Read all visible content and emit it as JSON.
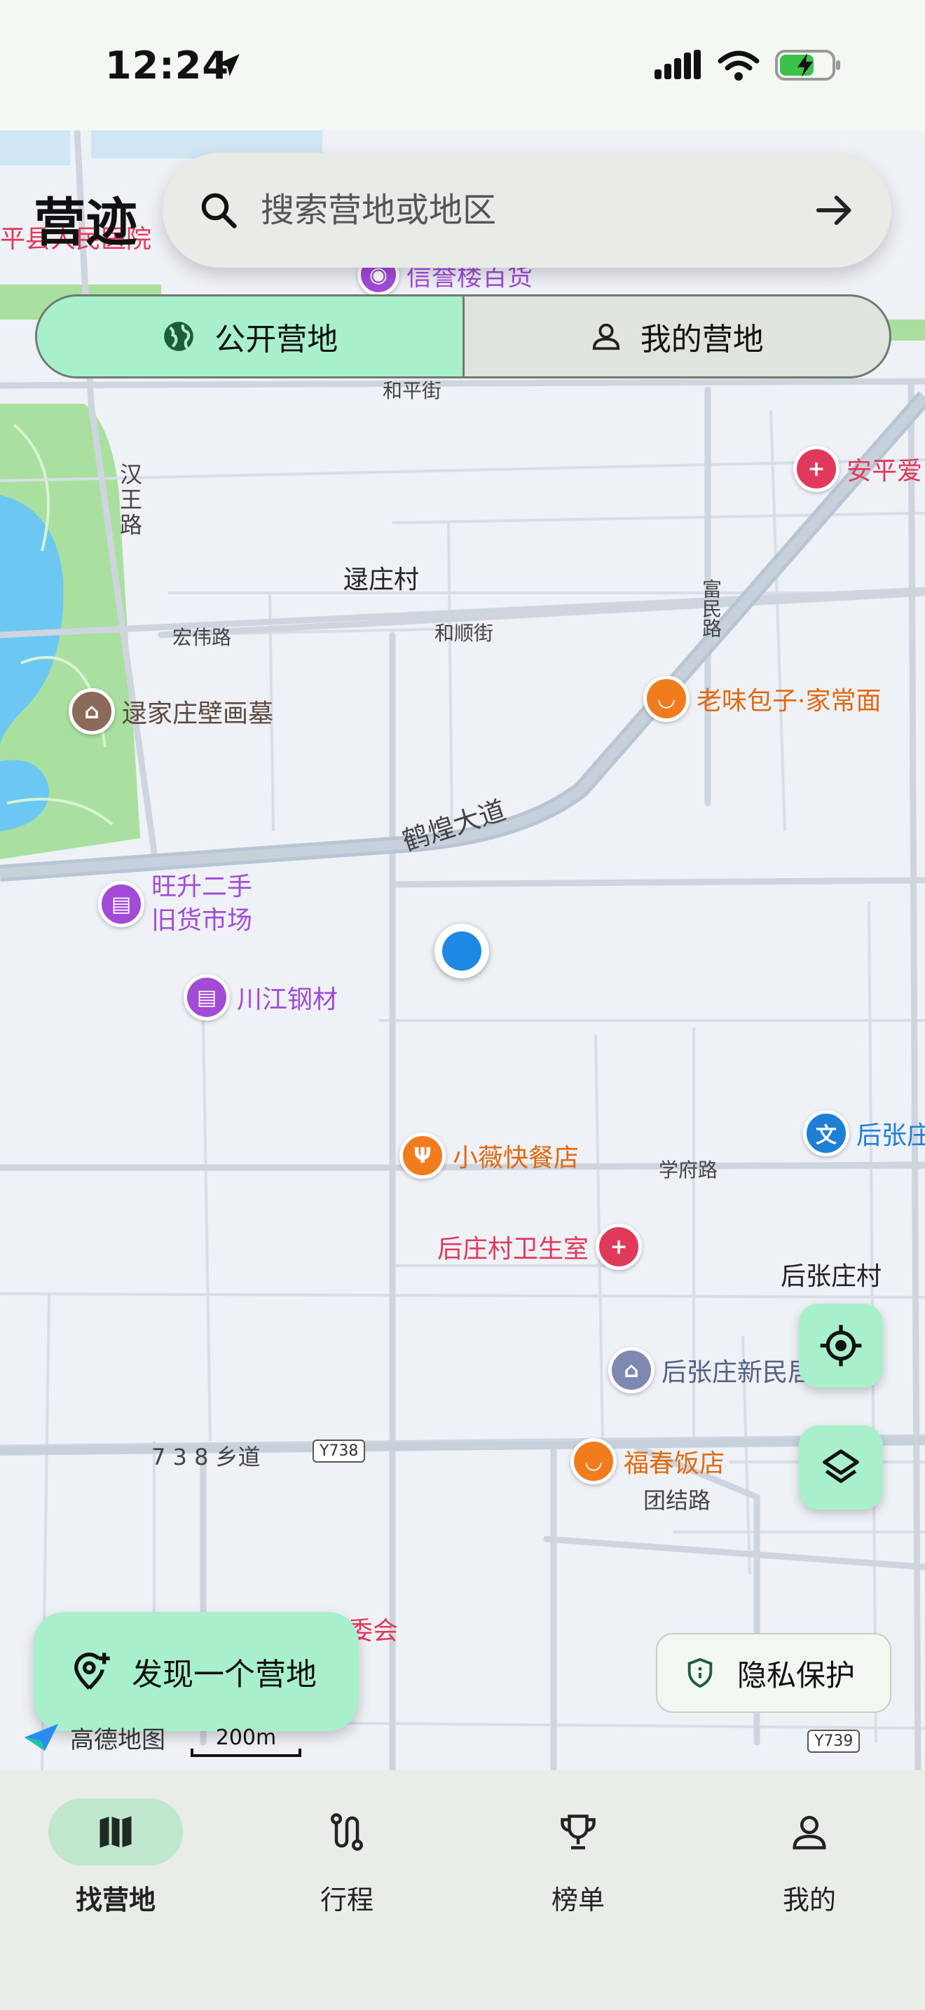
{
  "status_bar": {
    "time": "12:24"
  },
  "app": {
    "title": "营迹"
  },
  "search": {
    "placeholder": "搜索营地或地区"
  },
  "segment": {
    "public_label": "公开营地",
    "mine_label": "我的营地",
    "active": "public"
  },
  "map": {
    "roads": [
      "和平街",
      "汉王路",
      "宏伟路",
      "和顺街",
      "富民路",
      "鹤煌大道",
      "学府路",
      "7 3 8 乡道",
      "团结路"
    ],
    "road_badges": [
      "Y738",
      "Y739"
    ],
    "places": [
      "逯庄村",
      "后张庄村"
    ],
    "pois": [
      {
        "name": "平县人民医院",
        "color": "#e0395a"
      },
      {
        "name": "信誉楼百货",
        "color": "#a24bd6"
      },
      {
        "name": "安平爱",
        "color": "#e0395a"
      },
      {
        "name": "逯家庄壁画墓",
        "color": "#8a6a58"
      },
      {
        "name": "老味包子·家常面",
        "color": "#f07c1e"
      },
      {
        "name": "旺升二手",
        "name2": "旧货市场",
        "color": "#a24bd6"
      },
      {
        "name": "川江钢材",
        "color": "#a24bd6"
      },
      {
        "name": "小薇快餐店",
        "color": "#f07c1e"
      },
      {
        "name": "后张庄",
        "color": "#1f7fd6"
      },
      {
        "name": "后庄村卫生室",
        "color": "#e0395a"
      },
      {
        "name": "后张庄新民居",
        "color": "#7f88b0"
      },
      {
        "name": "福春饭店",
        "color": "#f07c1e"
      },
      {
        "name": "村委会",
        "color": "#e0395a"
      }
    ],
    "provider": "高德地图",
    "scale": "200m"
  },
  "actions": {
    "discover_label": "发现一个营地",
    "privacy_label": "隐私保护"
  },
  "nav": [
    {
      "label": "找营地",
      "icon": "map-icon",
      "active": true
    },
    {
      "label": "行程",
      "icon": "route-icon",
      "active": false
    },
    {
      "label": "榜单",
      "icon": "trophy-icon",
      "active": false
    },
    {
      "label": "我的",
      "icon": "person-icon",
      "active": false
    }
  ],
  "colors": {
    "accent": "#a8efcb",
    "nav_active": "#bfe8cf",
    "location_dot": "#1e88e5"
  }
}
